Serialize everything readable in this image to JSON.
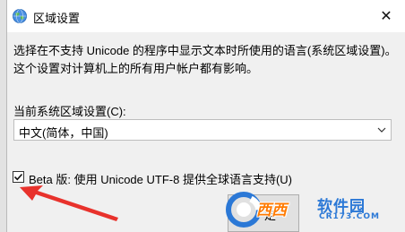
{
  "window": {
    "title": "区域设置",
    "close_glyph": "✕"
  },
  "main": {
    "description": "选择在不支持 Unicode 的程序中显示文本时所使用的语言(系统区域设置)。这个设置对计算机上的所有用户帐户都有影响。",
    "locale_label": "当前系统区域设置(C):",
    "locale_value": "中文(简体，中国)",
    "beta_checkbox": {
      "label": "Beta 版: 使用 Unicode UTF-8 提供全球语言支持(U)",
      "checked": true
    }
  },
  "footer": {
    "ok_button_partial": "定"
  },
  "watermark": {
    "brand": "西西",
    "cn_text": "软件园",
    "domain": "CR173.COM"
  },
  "colors": {
    "annotation_arrow": "#e8322c",
    "watermark_orange": "#ff7a00",
    "watermark_blue": "#2b78d6"
  }
}
